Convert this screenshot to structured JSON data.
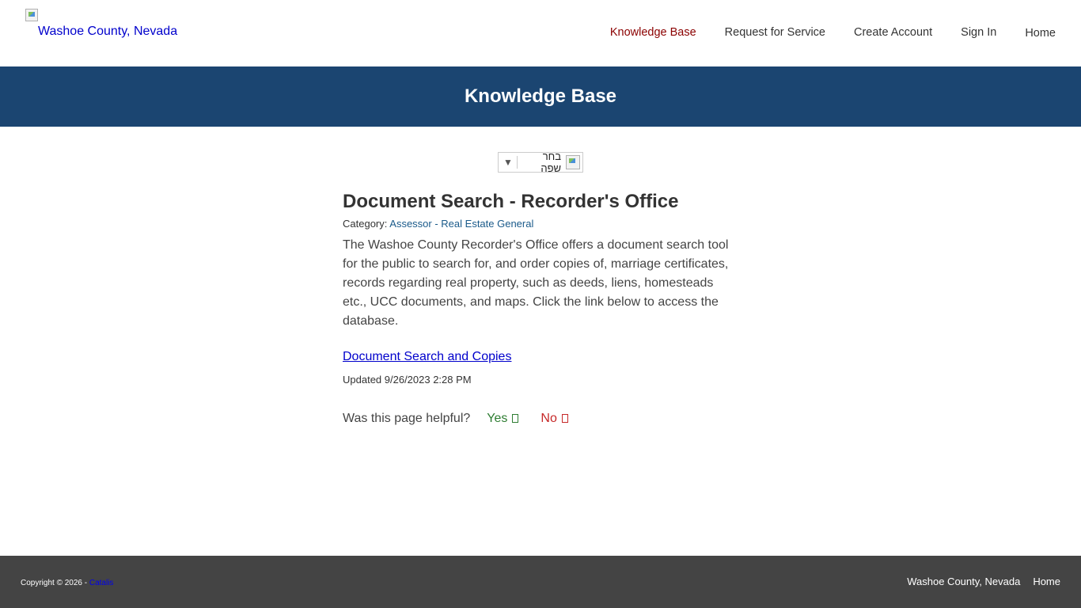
{
  "header": {
    "logo_alt": "Washoe County, Nevada",
    "nav": [
      {
        "label": "Knowledge Base",
        "active": true
      },
      {
        "label": "Request for Service"
      },
      {
        "label": "Create Account"
      },
      {
        "label": "Sign In"
      },
      {
        "label": "Home"
      }
    ]
  },
  "banner": {
    "title": "Knowledge Base"
  },
  "language": {
    "label": "בחר שפה",
    "arrow": "▼"
  },
  "article": {
    "title": "Document Search - Recorder's Office",
    "category_label": "Category:",
    "category_value": "Assessor - Real Estate General",
    "body": "The Washoe County Recorder's Office offers a document search tool for the public to search for, and order copies of, marriage certificates, records regarding real property, such as deeds, liens, homesteads etc., UCC documents, and maps. Click the link below to access the database.",
    "link": "Document Search and Copies",
    "updated": "Updated 9/26/2023 2:28 PM"
  },
  "feedback": {
    "question": "Was this page helpful?",
    "yes": "Yes",
    "no": "No"
  },
  "footer": {
    "copyright": "Copyright © 2026 - ",
    "copyright_link": "Catalis",
    "links": [
      "Washoe County, Nevada",
      "Home"
    ]
  },
  "colors": {
    "banner": "#1b4571",
    "footer": "#444444",
    "nav_active": "#8b0000",
    "yes": "#2e7d32",
    "no": "#c62828"
  }
}
